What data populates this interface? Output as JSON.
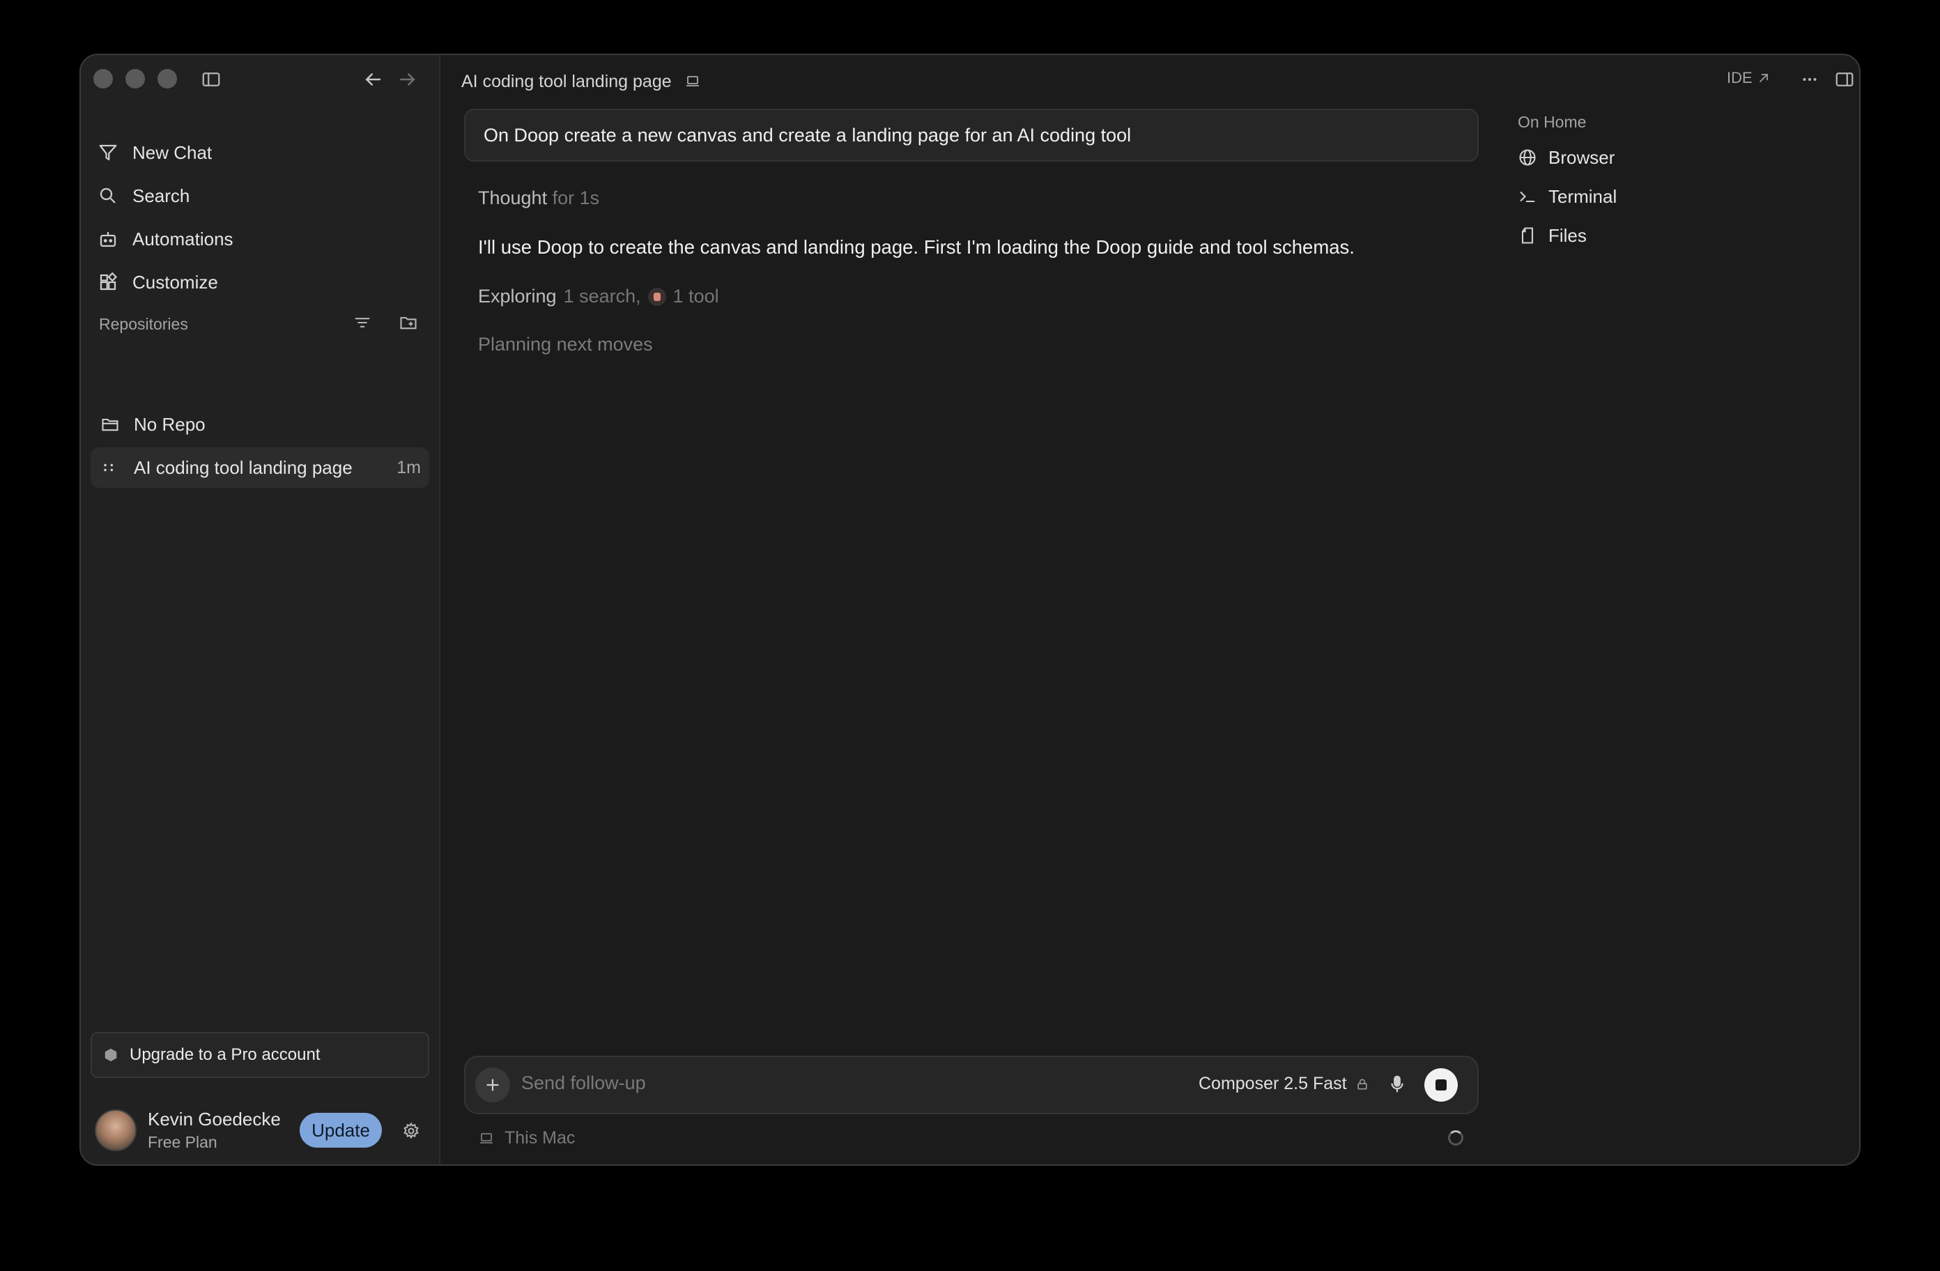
{
  "window": {
    "title": "AI coding tool landing page"
  },
  "sidebar": {
    "nav": [
      {
        "label": "New Chat",
        "icon": "new-chat-icon"
      },
      {
        "label": "Search",
        "icon": "search-icon"
      },
      {
        "label": "Automations",
        "icon": "robot-icon"
      },
      {
        "label": "Customize",
        "icon": "customize-icon"
      }
    ],
    "repositories_label": "Repositories",
    "repos": [
      {
        "label": "No Repo",
        "icon": "folder-icon",
        "time": ""
      },
      {
        "label": "AI coding tool landing page",
        "icon": "drag-handle-icon",
        "time": "1m"
      }
    ],
    "upgrade_label": "Upgrade to a Pro account",
    "user": {
      "name": "Kevin Goedecke",
      "plan": "Free Plan",
      "update_label": "Update"
    }
  },
  "main": {
    "prompt": "On Doop create a new canvas and create a landing page for an AI coding tool",
    "thought": {
      "label": "Thought",
      "duration": "for 1s"
    },
    "message": "I'll use Doop to create the canvas and landing page. First I'm loading the Doop guide and tool schemas.",
    "exploring": {
      "label": "Exploring",
      "searches": "1 search,",
      "tools": "1 tool"
    },
    "status": "Planning next moves"
  },
  "right_panel": {
    "section_label": "On Home",
    "items": [
      {
        "label": "Browser",
        "icon": "globe-icon"
      },
      {
        "label": "Terminal",
        "icon": "terminal-icon"
      },
      {
        "label": "Files",
        "icon": "file-icon"
      }
    ],
    "ide_label": "IDE"
  },
  "composer": {
    "placeholder": "Send follow-up",
    "model": "Composer 2.5 Fast",
    "environment": "This Mac"
  }
}
